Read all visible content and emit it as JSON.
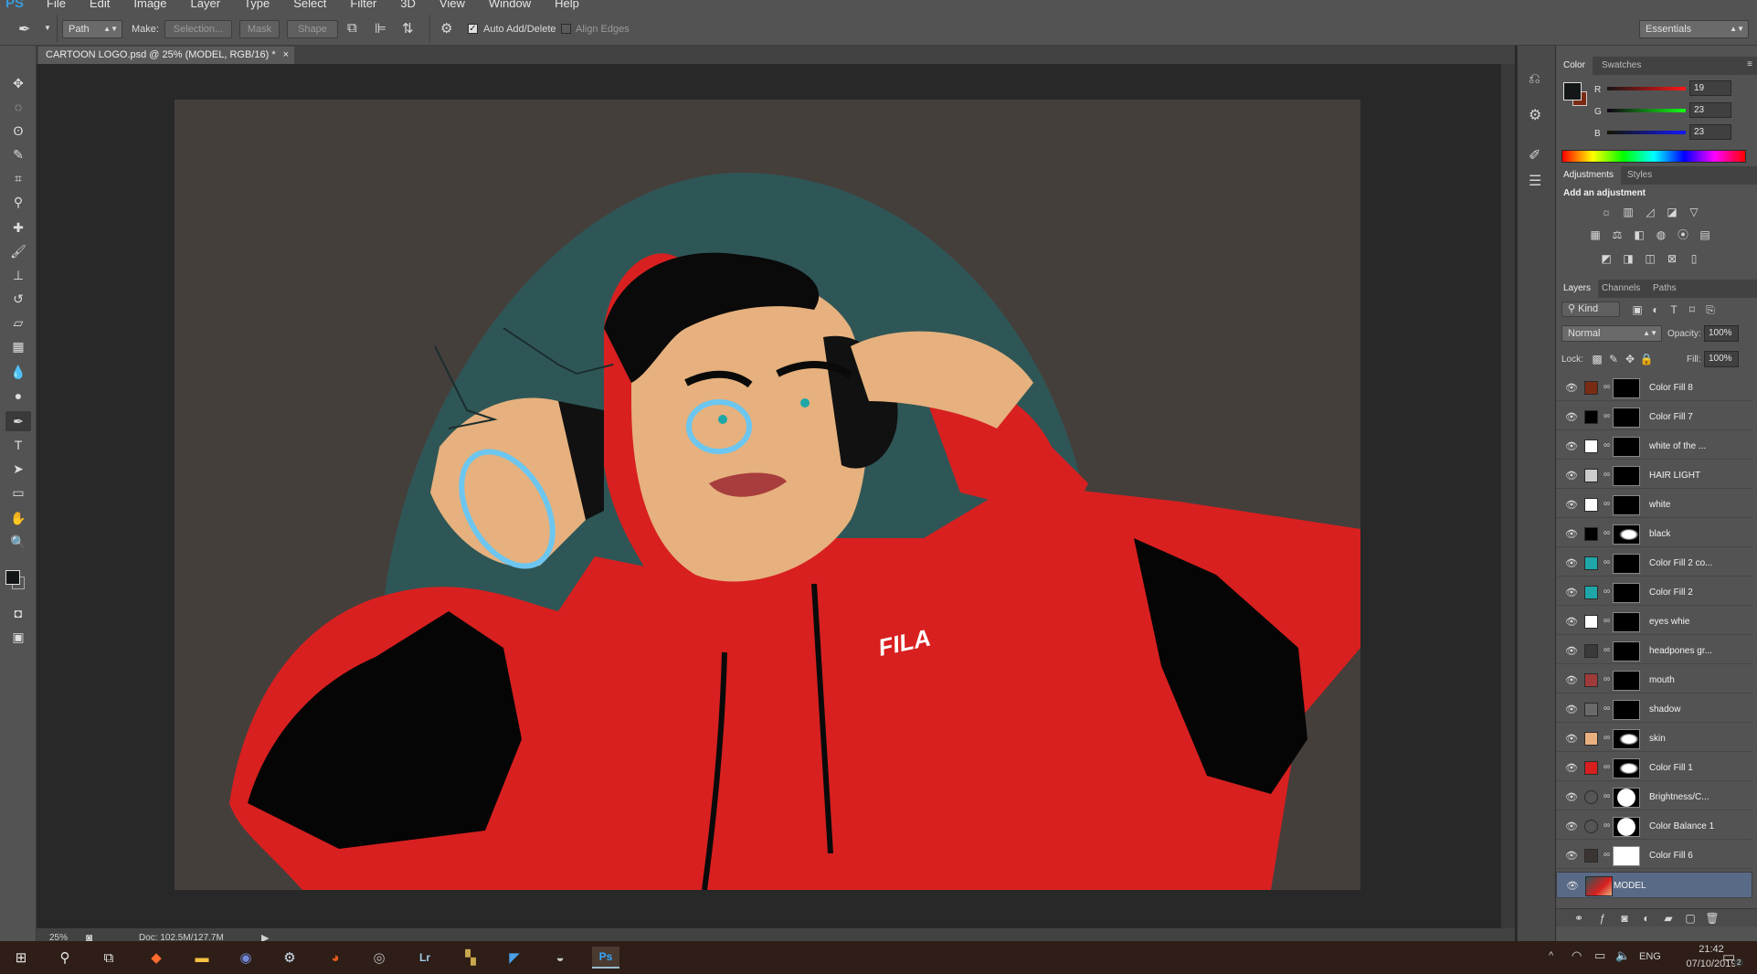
{
  "app": {
    "logo": "PS"
  },
  "menu": [
    "File",
    "Edit",
    "Image",
    "Layer",
    "Type",
    "Select",
    "Filter",
    "3D",
    "View",
    "Window",
    "Help"
  ],
  "options": {
    "tool_mode": "Path",
    "make_label": "Make:",
    "selection_btn": "Selection...",
    "mask_btn": "Mask",
    "shape_btn": "Shape",
    "auto_add_delete": "Auto Add/Delete",
    "align_edges": "Align Edges",
    "workspace": "Essentials"
  },
  "document": {
    "tab_title": "CARTOON LOGO.psd @ 25% (MODEL, RGB/16) *"
  },
  "status": {
    "zoom": "25%",
    "doc_size": "Doc: 102.5M/127.7M"
  },
  "color_panel": {
    "tabs": [
      "Color",
      "Swatches"
    ],
    "r_label": "R",
    "g_label": "G",
    "b_label": "B",
    "r": "19",
    "g": "23",
    "b": "23",
    "foreground": "#131717",
    "background": "#7a2b14"
  },
  "adjustments_panel": {
    "tabs": [
      "Adjustments",
      "Styles"
    ],
    "heading": "Add an adjustment"
  },
  "layers_panel": {
    "tabs": [
      "Layers",
      "Channels",
      "Paths"
    ],
    "filter_kind": "Kind",
    "blend_mode": "Normal",
    "opacity_label": "Opacity:",
    "opacity": "100%",
    "lock_label": "Lock:",
    "fill_label": "Fill:",
    "fill": "100%",
    "layers": [
      {
        "name": "Color Fill 8",
        "swatch": "#7a2b14",
        "mask": "black"
      },
      {
        "name": "Color Fill 7",
        "swatch": "#000000",
        "mask": "black"
      },
      {
        "name": "white of the ...",
        "swatch": "#ffffff",
        "mask": "black"
      },
      {
        "name": "HAIR LIGHT",
        "swatch": "#cccccc",
        "mask": "black"
      },
      {
        "name": "white",
        "swatch": "#ffffff",
        "mask": "black"
      },
      {
        "name": "black",
        "swatch": "#000000",
        "mask": "shape"
      },
      {
        "name": "Color Fill 2 co...",
        "swatch": "#1fa6a8",
        "mask": "black"
      },
      {
        "name": "Color Fill 2",
        "swatch": "#1fa6a8",
        "mask": "black"
      },
      {
        "name": "eyes whie",
        "swatch": "#ffffff",
        "mask": "black"
      },
      {
        "name": "headpones gr...",
        "swatch": "#3a3a3a",
        "mask": "black"
      },
      {
        "name": "mouth",
        "swatch": "#a03b3b",
        "mask": "black"
      },
      {
        "name": "shadow",
        "swatch": "#6a6a6a",
        "mask": "black"
      },
      {
        "name": "skin",
        "swatch": "#e8b07f",
        "mask": "shape"
      },
      {
        "name": "Color Fill 1",
        "swatch": "#d71f1f",
        "mask": "shape"
      },
      {
        "name": "Brightness/C...",
        "swatch": "adjust",
        "mask": "white-blob"
      },
      {
        "name": "Color Balance 1",
        "swatch": "adjust",
        "mask": "white-blob"
      },
      {
        "name": "Color Fill 6",
        "swatch": "#3b3532",
        "mask": "white"
      },
      {
        "name": "MODEL",
        "swatch": "photo",
        "mask": "none"
      }
    ]
  },
  "taskbar": {
    "lang": "ENG",
    "time": "21:42",
    "date": "07/10/2019",
    "notif": "2"
  }
}
